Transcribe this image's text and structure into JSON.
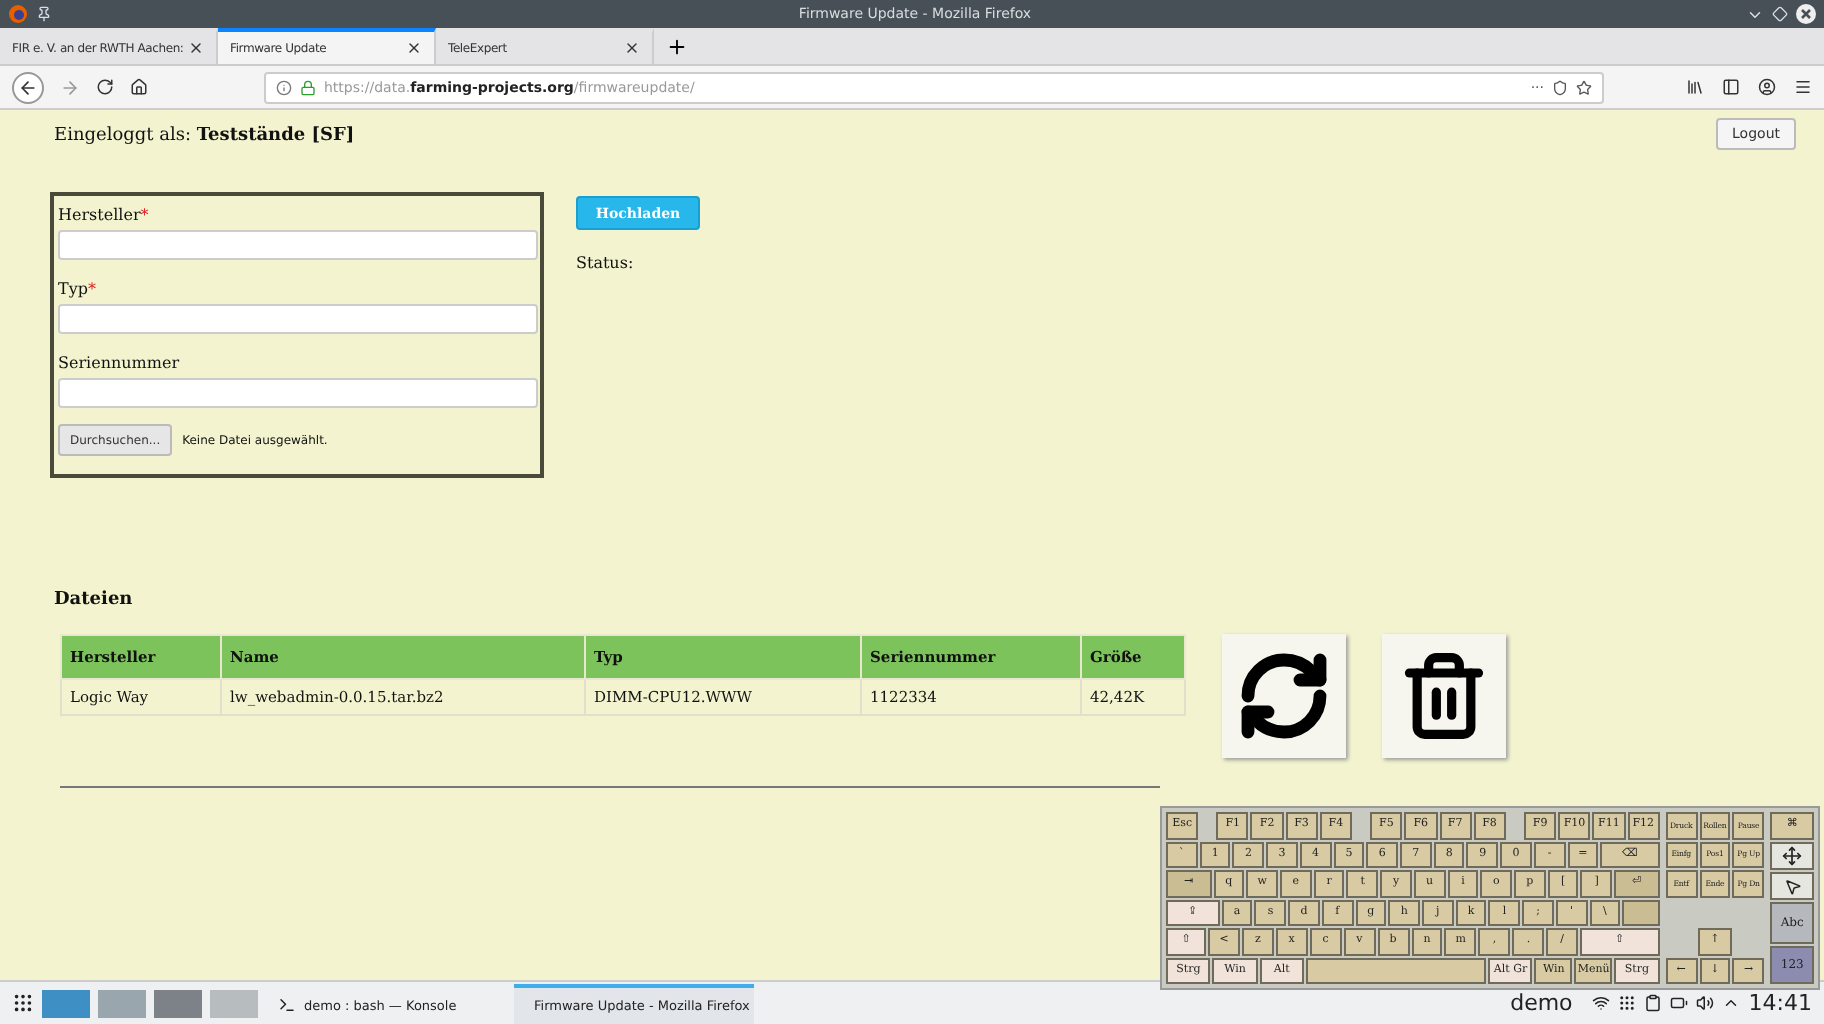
{
  "window": {
    "title": "Firmware Update - Mozilla Firefox"
  },
  "tabs": [
    {
      "label": "FIR e. V. an der RWTH Aachen:",
      "selected": false
    },
    {
      "label": "Firmware Update",
      "selected": true
    },
    {
      "label": "TeleExpert",
      "selected": false
    }
  ],
  "address_bar": {
    "url": "https://data.**farming-projects.org**/firmwareupdate/",
    "more": "···"
  },
  "page": {
    "login": "Eingeloggt als: **Teststände [SF]**",
    "logout_button": "Logout",
    "form": {
      "required_mark": "*",
      "fields": [
        {
          "label": "Hersteller",
          "required": true
        },
        {
          "label": "Typ",
          "required": true
        },
        {
          "label": "Seriennummer",
          "required": false
        }
      ],
      "file_button": "Durchsuchen...",
      "file_status": "Keine Datei ausgewählt."
    },
    "upload_button": "Hochladen",
    "status_label": "Status:",
    "files_title": "Dateien",
    "table": {
      "columns": [
        "Hersteller",
        "Name",
        "Typ",
        "Seriennummer",
        "Größe"
      ],
      "rows": [
        [
          "Logic Way",
          "lw_webadmin-0.0.15.tar.bz2",
          "DIMM-CPU12.WWW",
          "1122334",
          "42,42K"
        ]
      ]
    }
  },
  "keyboard": {
    "main": [
      [
        {
          "label": "Esc",
          "kind": "key"
        },
        {
          "kind": "gap"
        },
        {
          "label": "F1",
          "kind": "key"
        },
        {
          "label": "F2",
          "kind": "key"
        },
        {
          "label": "F3",
          "kind": "key"
        },
        {
          "label": "F4",
          "kind": "key"
        },
        {
          "kind": "gap"
        },
        {
          "label": "F5",
          "kind": "key"
        },
        {
          "label": "F6",
          "kind": "key"
        },
        {
          "label": "F7",
          "kind": "key"
        },
        {
          "label": "F8",
          "kind": "key"
        },
        {
          "kind": "gap"
        },
        {
          "label": "F9",
          "kind": "key"
        },
        {
          "label": "F10",
          "kind": "key"
        },
        {
          "label": "F11",
          "kind": "key"
        },
        {
          "label": "F12",
          "kind": "key"
        }
      ],
      [
        {
          "label": "`",
          "kind": "key"
        },
        {
          "label": "1",
          "kind": "key"
        },
        {
          "label": "2",
          "kind": "key"
        },
        {
          "label": "3",
          "kind": "key"
        },
        {
          "label": "4",
          "kind": "key"
        },
        {
          "label": "5",
          "kind": "key"
        },
        {
          "label": "6",
          "kind": "key"
        },
        {
          "label": "7",
          "kind": "key"
        },
        {
          "label": "8",
          "kind": "key"
        },
        {
          "label": "9",
          "kind": "key"
        },
        {
          "label": "0",
          "kind": "key"
        },
        {
          "label": "-",
          "kind": "key"
        },
        {
          "label": "=",
          "kind": "key"
        },
        {
          "label": "⌫",
          "kind": "long"
        }
      ],
      [
        {
          "label": "⇥",
          "kind": "tab"
        },
        {
          "label": "q",
          "kind": "key"
        },
        {
          "label": "w",
          "kind": "key"
        },
        {
          "label": "e",
          "kind": "key"
        },
        {
          "label": "r",
          "kind": "key"
        },
        {
          "label": "t",
          "kind": "key"
        },
        {
          "label": "y",
          "kind": "key"
        },
        {
          "label": "u",
          "kind": "key"
        },
        {
          "label": "i",
          "kind": "key"
        },
        {
          "label": "o",
          "kind": "key"
        },
        {
          "label": "p",
          "kind": "key"
        },
        {
          "label": "[",
          "kind": "key"
        },
        {
          "label": "]",
          "kind": "key"
        },
        {
          "label": "⏎",
          "kind": "enter"
        }
      ],
      [
        {
          "label": "⇪",
          "kind": "caps"
        },
        {
          "label": "a",
          "kind": "key"
        },
        {
          "label": "s",
          "kind": "key"
        },
        {
          "label": "d",
          "kind": "key"
        },
        {
          "label": "f",
          "kind": "key"
        },
        {
          "label": "g",
          "kind": "key"
        },
        {
          "label": "h",
          "kind": "key"
        },
        {
          "label": "j",
          "kind": "key"
        },
        {
          "label": "k",
          "kind": "key"
        },
        {
          "label": "l",
          "kind": "key"
        },
        {
          "label": ";",
          "kind": "key"
        },
        {
          "label": "'",
          "kind": "key"
        },
        {
          "label": "\\",
          "kind": "key"
        },
        {
          "kind": "enter_tail"
        }
      ],
      [
        {
          "label": "⇧",
          "kind": "lshift"
        },
        {
          "label": "<",
          "kind": "key"
        },
        {
          "label": "z",
          "kind": "key"
        },
        {
          "label": "x",
          "kind": "key"
        },
        {
          "label": "c",
          "kind": "key"
        },
        {
          "label": "v",
          "kind": "key"
        },
        {
          "label": "b",
          "kind": "key"
        },
        {
          "label": "n",
          "kind": "key"
        },
        {
          "label": "m",
          "kind": "key"
        },
        {
          "label": ",",
          "kind": "key"
        },
        {
          "label": ".",
          "kind": "key"
        },
        {
          "label": "/",
          "kind": "key"
        },
        {
          "label": "⇧",
          "kind": "rshift"
        }
      ],
      [
        {
          "label": "Strg",
          "kind": "mod"
        },
        {
          "label": "Win",
          "kind": "mod"
        },
        {
          "label": "Alt",
          "kind": "mod"
        },
        {
          "kind": "space"
        },
        {
          "label": "Alt Gr",
          "kind": "mod"
        },
        {
          "label": "Win",
          "kind": "key"
        },
        {
          "label": "Menü",
          "kind": "key"
        },
        {
          "label": "Strg",
          "kind": "mod"
        }
      ]
    ],
    "nav": [
      [
        {
          "label": "Druck",
          "kind": "key"
        },
        {
          "label": "Rollen",
          "kind": "key"
        },
        {
          "label": "Pause",
          "kind": "key"
        }
      ],
      [
        {
          "label": "Einfg",
          "kind": "key"
        },
        {
          "label": "Pos1",
          "kind": "key"
        },
        {
          "label": "Pg Up",
          "kind": "key"
        }
      ],
      [
        {
          "label": "Entf",
          "kind": "key"
        },
        {
          "label": "Ende",
          "kind": "key"
        },
        {
          "label": "Pg Dn",
          "kind": "key"
        }
      ],
      [
        {
          "kind": "none"
        },
        {
          "kind": "none"
        },
        {
          "kind": "none"
        }
      ],
      [
        {
          "kind": "none"
        },
        {
          "label": "↑",
          "kind": "key"
        },
        {
          "kind": "none"
        }
      ],
      [
        {
          "label": "←",
          "kind": "key"
        },
        {
          "label": "↓",
          "kind": "key"
        },
        {
          "label": "→",
          "kind": "key"
        }
      ]
    ],
    "side": [
      {
        "label": "⌘",
        "kind": "key"
      },
      {
        "kind": "move"
      },
      {
        "kind": "pointer"
      },
      {
        "label": "Abc",
        "kind": "abc"
      },
      {
        "label": "123",
        "kind": "num"
      }
    ]
  },
  "taskbar": {
    "tasks": [
      {
        "label": "demo : bash — Konsole",
        "kind": "terminal",
        "selected": false
      },
      {
        "label": "Firmware Update - Mozilla Firefox",
        "kind": "browser",
        "selected": true
      }
    ],
    "user": "demo",
    "clock": "14:41"
  }
}
